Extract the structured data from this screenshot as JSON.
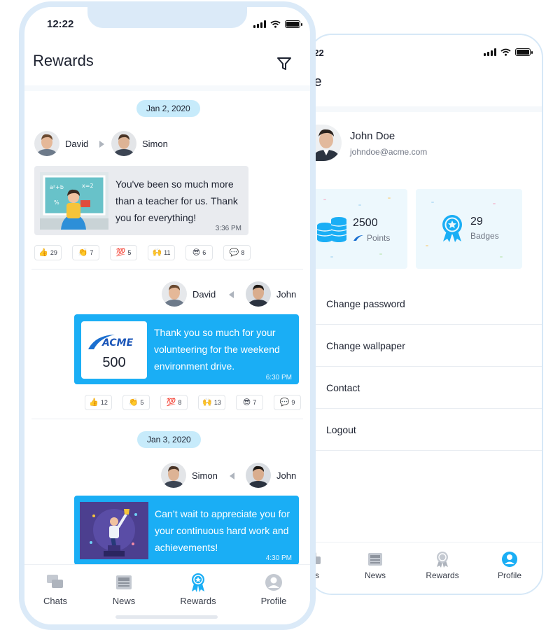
{
  "colors": {
    "accent": "#1aaef5",
    "bubble_grey": "#e9ebef",
    "date_pill": "#c7ebfb",
    "frame": "#dbeaf8",
    "stat_card": "#edf8fd"
  },
  "rewards_screen": {
    "status_time": "12:22",
    "title": "Rewards",
    "filter_icon": "filter-icon",
    "feed": [
      {
        "date": "Jan 2, 2020",
        "sender": "David",
        "recipient": "Simon",
        "message": "You've been so much more than a teacher for us. Thank you for everything!",
        "time": "3:36 PM",
        "image": "teacher-illustration",
        "reactions": [
          {
            "icon": "👍",
            "count": "29"
          },
          {
            "icon": "👏",
            "count": "7"
          },
          {
            "icon": "💯",
            "count": "5"
          },
          {
            "icon": "🙌",
            "count": "11"
          },
          {
            "icon": "😎",
            "count": "6"
          },
          {
            "icon": "💬",
            "count": "8"
          }
        ]
      },
      {
        "sender": "David",
        "recipient": "John",
        "message": "Thank you so much for your volunteering for the weekend environment drive.",
        "time": "6:30 PM",
        "card_brand": "ACME",
        "card_points": "500",
        "reactions": [
          {
            "icon": "👍",
            "count": "12"
          },
          {
            "icon": "👏",
            "count": "5"
          },
          {
            "icon": "💯",
            "count": "8"
          },
          {
            "icon": "🙌",
            "count": "13"
          },
          {
            "icon": "😎",
            "count": "7"
          },
          {
            "icon": "💬",
            "count": "9"
          }
        ]
      },
      {
        "date": "Jan 3, 2020",
        "sender": "Simon",
        "recipient": "John",
        "message": "Can’t wait to appreciate you for your continuous hard work and achievements!",
        "time": "4:30 PM",
        "image": "achievement-illustration"
      }
    ],
    "tabs": [
      {
        "label": "Chats",
        "icon": "chats-icon"
      },
      {
        "label": "News",
        "icon": "news-icon"
      },
      {
        "label": "Rewards",
        "icon": "rewards-icon",
        "active": true
      },
      {
        "label": "Profile",
        "icon": "profile-icon"
      }
    ]
  },
  "profile_screen": {
    "status_time": ":22",
    "title": "file",
    "user": {
      "name": "John Doe",
      "email": "johndoe@acme.com"
    },
    "stats": [
      {
        "value": "2500",
        "label": "Points",
        "icon": "coins-icon"
      },
      {
        "value": "29",
        "label": "Badges",
        "icon": "badge-icon"
      }
    ],
    "menu": [
      "Change password",
      "Change wallpaper",
      "Contact",
      "Logout"
    ],
    "tabs": [
      {
        "label": "ats",
        "icon": "chats-icon"
      },
      {
        "label": "News",
        "icon": "news-icon"
      },
      {
        "label": "Rewards",
        "icon": "rewards-icon"
      },
      {
        "label": "Profile",
        "icon": "profile-icon",
        "active": true
      }
    ]
  }
}
